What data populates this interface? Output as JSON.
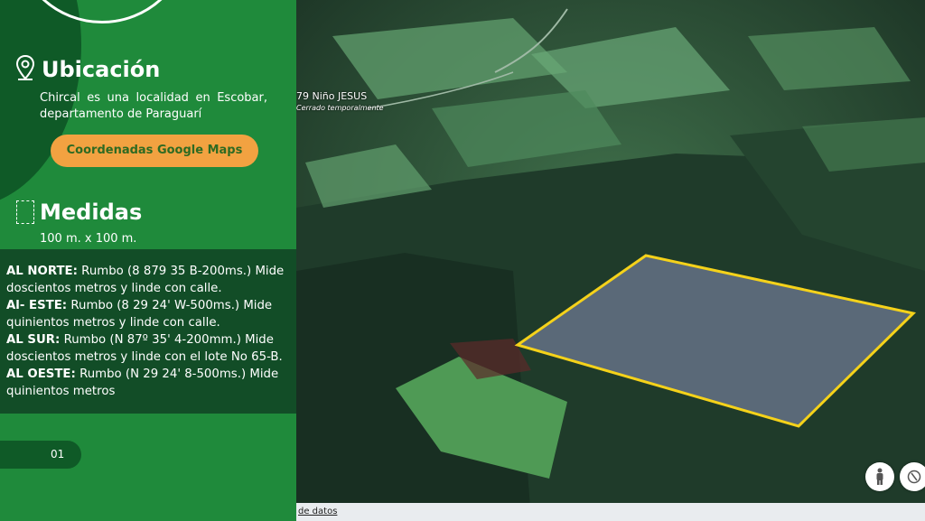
{
  "ubicacion": {
    "title": "Ubicación",
    "description": "Chircal es una localidad en Escobar, departamento de Paraguarí",
    "button": "Coordenadas Google Maps"
  },
  "medidas": {
    "title": "Medidas",
    "value": "100 m. x 100 m."
  },
  "linderos": {
    "norte_label": "AL NORTE:",
    "norte_text": "Rumbo (8 879 35 B-200ms.) Mide doscientos metros y linde con calle.",
    "este_label": "Al- ESTE:",
    "este_text": "Rumbo (8 29 24' W-500ms.) Mide quinientos metros y linde con calle.",
    "sur_label": "AL SUR:",
    "sur_text": "Rumbo (N 87º 35' 4-200mm.) Mide doscientos metros y linde con el lote No 65-B.",
    "oeste_label": "AL OESTE:",
    "oeste_text": "Rumbo (N 29 24' 8-500ms.) Mide quinientos metros"
  },
  "page_number": "01",
  "map": {
    "place_label": "79 Niño JESUS",
    "place_sublabel": "Cerrado temporalmente",
    "footer": "de datos",
    "icons": [
      "map-pin-icon",
      "ruler-icon",
      "pegman-icon",
      "compass-icon"
    ]
  },
  "colors": {
    "panel_green": "#1f8a3b",
    "dark_green": "#0f5a27",
    "accent_orange": "#f2a241",
    "plot_outline": "#f5d21a"
  }
}
